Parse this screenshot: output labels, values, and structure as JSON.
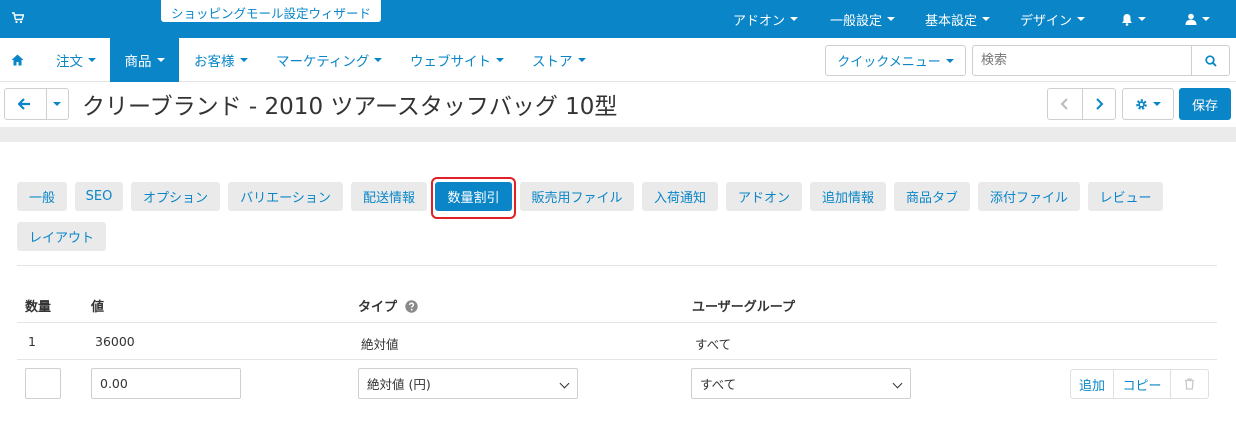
{
  "topbar": {
    "wizard_label": "ショッピングモール設定ウィザード",
    "menus": [
      {
        "label": "アドオン"
      },
      {
        "label": "一般設定"
      },
      {
        "label": "基本設定"
      },
      {
        "label": "デザイン"
      }
    ],
    "icons": [
      "cart-icon",
      "bell-icon",
      "user-icon"
    ]
  },
  "nav": {
    "items": [
      {
        "label": "注文"
      },
      {
        "label": "商品"
      },
      {
        "label": "お客様"
      },
      {
        "label": "マーケティング"
      },
      {
        "label": "ウェブサイト"
      },
      {
        "label": "ストア"
      }
    ],
    "active": "商品",
    "quick_menu_label": "クイックメニュー",
    "search_placeholder": "検索"
  },
  "title": {
    "text": "クリーブランド - 2010 ツアースタッフバッグ 10型",
    "save_label": "保存"
  },
  "tabs": [
    {
      "label": "一般"
    },
    {
      "label": "SEO"
    },
    {
      "label": "オプション"
    },
    {
      "label": "バリエーション"
    },
    {
      "label": "配送情報"
    },
    {
      "label": "数量割引"
    },
    {
      "label": "販売用ファイル"
    },
    {
      "label": "入荷通知"
    },
    {
      "label": "アドオン"
    },
    {
      "label": "追加情報"
    },
    {
      "label": "商品タブ"
    },
    {
      "label": "添付ファイル"
    },
    {
      "label": "レビュー"
    },
    {
      "label": "レイアウト"
    }
  ],
  "active_tab": "数量割引",
  "table": {
    "headers": {
      "quantity": "数量",
      "value": "値",
      "type": "タイプ",
      "usergroup": "ユーザーグループ"
    },
    "rows": [
      {
        "quantity": "1",
        "value": "36000",
        "type": "絶対値",
        "usergroup": "すべて"
      }
    ],
    "new_row": {
      "quantity": "",
      "value": "0.00",
      "type": "絶対値 (円)",
      "usergroup": "すべて"
    },
    "actions": {
      "add_label": "追加",
      "copy_label": "コピー"
    }
  },
  "colors": {
    "primary": "#0a86c8",
    "highlight": "#e01f26",
    "tab_bg": "#eaeaea"
  }
}
